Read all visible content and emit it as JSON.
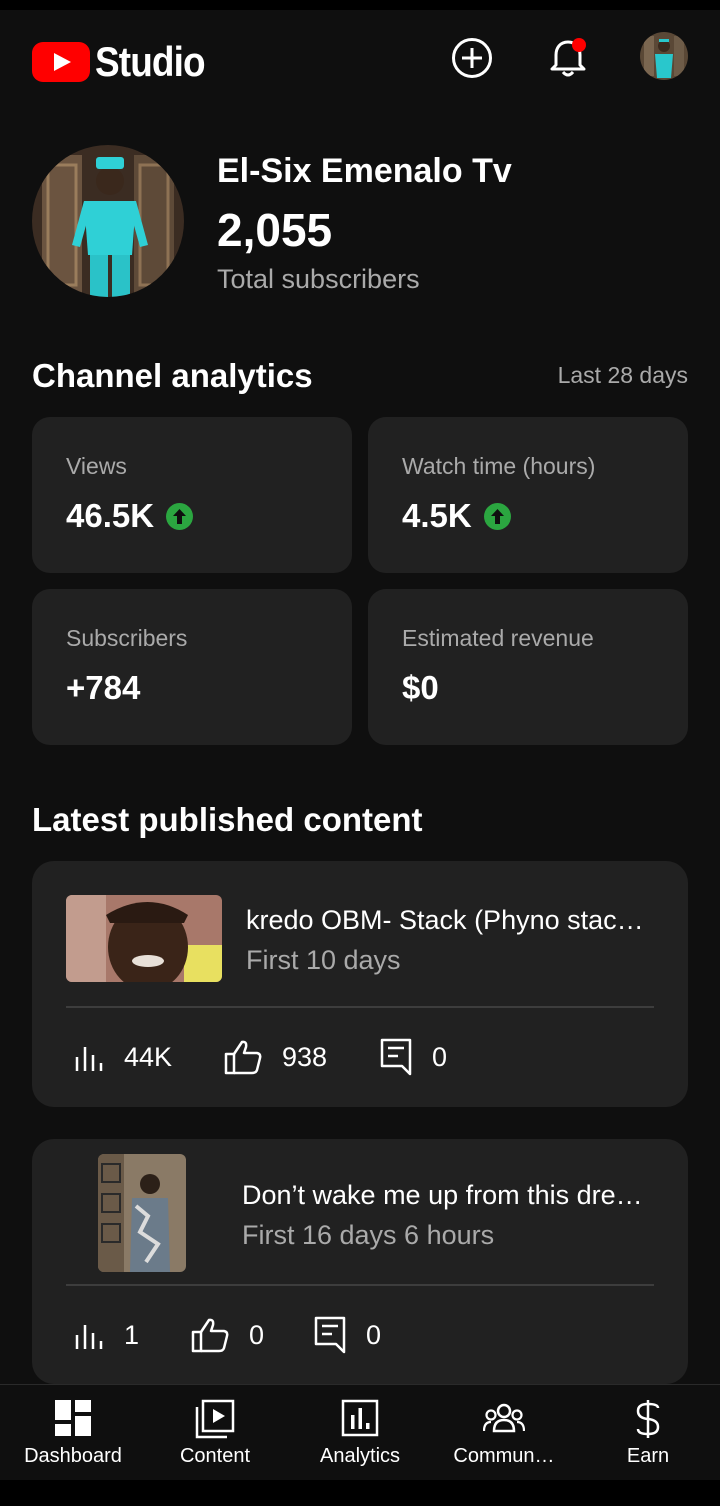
{
  "app": {
    "logo_text": "Studio"
  },
  "header": {
    "create_icon": "plus-circle-icon",
    "bell_icon": "bell-icon",
    "has_notification": true
  },
  "channel": {
    "name": "El-Six Emenalo Tv",
    "subscribers": "2,055",
    "subscribers_label": "Total subscribers"
  },
  "analytics": {
    "title": "Channel analytics",
    "range": "Last 28 days",
    "cards": [
      {
        "label": "Views",
        "value": "46.5K",
        "trend": "up"
      },
      {
        "label": "Watch time (hours)",
        "value": "4.5K",
        "trend": "up"
      },
      {
        "label": "Subscribers",
        "value": "+784",
        "trend": "none"
      },
      {
        "label": "Estimated revenue",
        "value": "$0",
        "trend": "none"
      }
    ]
  },
  "latest": {
    "title": "Latest published content",
    "videos": [
      {
        "title": "kredo OBM- Stack (Phyno stac…",
        "period": "First 10 days",
        "views": "44K",
        "likes": "938",
        "comments": "0"
      },
      {
        "title": "Don’t wake me up from this dre…",
        "period": "First 16 days 6 hours",
        "views": "1",
        "likes": "0",
        "comments": "0"
      }
    ]
  },
  "nav": {
    "items": [
      {
        "label": "Dashboard",
        "icon": "dashboard-icon"
      },
      {
        "label": "Content",
        "icon": "content-icon"
      },
      {
        "label": "Analytics",
        "icon": "analytics-icon"
      },
      {
        "label": "Commun…",
        "icon": "community-icon"
      },
      {
        "label": "Earn",
        "icon": "dollar-icon"
      }
    ]
  },
  "colors": {
    "accent": "#ff0000",
    "trend_up": "#2ba640",
    "card": "#212121",
    "background": "#0f0f0f",
    "muted": "#aaaaaa"
  }
}
